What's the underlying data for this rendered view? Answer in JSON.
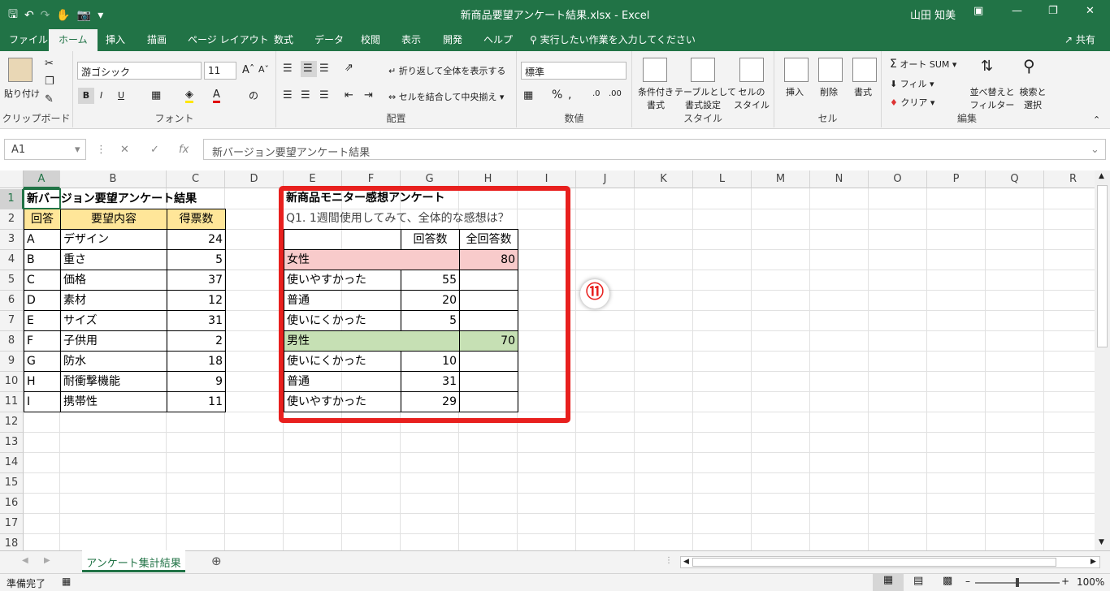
{
  "window": {
    "title": "新商品要望アンケート結果.xlsx - Excel",
    "user": "山田 知美",
    "qat_icons": [
      "save-icon",
      "undo-icon",
      "redo-icon",
      "touch-mode-icon",
      "camera-icon",
      "customize-icon"
    ]
  },
  "tabs": [
    "ファイル",
    "ホーム",
    "挿入",
    "描画",
    "ページ レイアウト",
    "数式",
    "データ",
    "校閲",
    "表示",
    "開発",
    "ヘルプ"
  ],
  "tellme": "実行したい作業を入力してください",
  "share": "共有",
  "ribbon": {
    "clipboard": {
      "paste": "貼り付け",
      "label": "クリップボード"
    },
    "font": {
      "name": "游ゴシック",
      "size": "11",
      "bold": "B",
      "italic": "I",
      "underline": "U",
      "label": "フォント"
    },
    "alignment": {
      "wrap": "折り返して全体を表示する",
      "merge": "セルを結合して中央揃え",
      "label": "配置"
    },
    "number": {
      "format": "標準",
      "percent": "%",
      "comma": ",",
      "label": "数値"
    },
    "styles": {
      "conditional": [
        "条件付き",
        "書式"
      ],
      "table": [
        "テーブルとして",
        "書式設定"
      ],
      "cell": [
        "セルの",
        "スタイル"
      ],
      "label": "スタイル"
    },
    "cells": {
      "insert": "挿入",
      "delete": "削除",
      "format": "書式",
      "label": "セル"
    },
    "editing": {
      "autosum": "オート SUM",
      "fill": "フィル",
      "clear": "クリア",
      "sort": [
        "並べ替えと",
        "フィルター"
      ],
      "find": [
        "検索と",
        "選択"
      ],
      "label": "編集"
    }
  },
  "formula": {
    "namebox": "A1",
    "content": "新バージョン要望アンケート結果"
  },
  "columns": [
    "A",
    "B",
    "C",
    "D",
    "E",
    "F",
    "G",
    "H",
    "I",
    "J",
    "K",
    "L",
    "M",
    "N",
    "O",
    "P",
    "Q",
    "R"
  ],
  "rows": [
    "1",
    "2",
    "3",
    "4",
    "5",
    "6",
    "7",
    "8",
    "9",
    "10",
    "11",
    "12",
    "13",
    "14",
    "15",
    "16",
    "17",
    "18"
  ],
  "table1": {
    "title": "新バージョン要望アンケート結果",
    "headers": [
      "回答",
      "要望内容",
      "得票数"
    ],
    "rows": [
      [
        "A",
        "デザイン",
        "24"
      ],
      [
        "B",
        "重さ",
        "5"
      ],
      [
        "C",
        "価格",
        "37"
      ],
      [
        "D",
        "素材",
        "12"
      ],
      [
        "E",
        "サイズ",
        "31"
      ],
      [
        "F",
        "子供用",
        "2"
      ],
      [
        "G",
        "防水",
        "18"
      ],
      [
        "H",
        "耐衝撃機能",
        "9"
      ],
      [
        "I",
        "携帯性",
        "11"
      ]
    ]
  },
  "table2": {
    "title": "新商品モニター感想アンケート",
    "question": "Q1. 1週間使用してみて、全体的な感想は？",
    "headers": [
      "回答数",
      "全回答数"
    ],
    "female": {
      "label": "女性",
      "total": "80"
    },
    "female_rows": [
      [
        "使いやすかった",
        "55"
      ],
      [
        "普通",
        "20"
      ],
      [
        "使いにくかった",
        "5"
      ]
    ],
    "male": {
      "label": "男性",
      "total": "70"
    },
    "male_rows": [
      [
        "使いにくかった",
        "10"
      ],
      [
        "普通",
        "31"
      ],
      [
        "使いやすかった",
        "29"
      ]
    ]
  },
  "annotation": "⑪",
  "sheet_tab": "アンケート集計結果",
  "status": {
    "ready": "準備完了",
    "zoom": "100%"
  },
  "colors": {
    "excel_green": "#217346",
    "female_bg": "#f8cbcb",
    "male_bg": "#c6e0b4",
    "header_bg": "#ffe699",
    "callout_red": "#e8201e"
  }
}
